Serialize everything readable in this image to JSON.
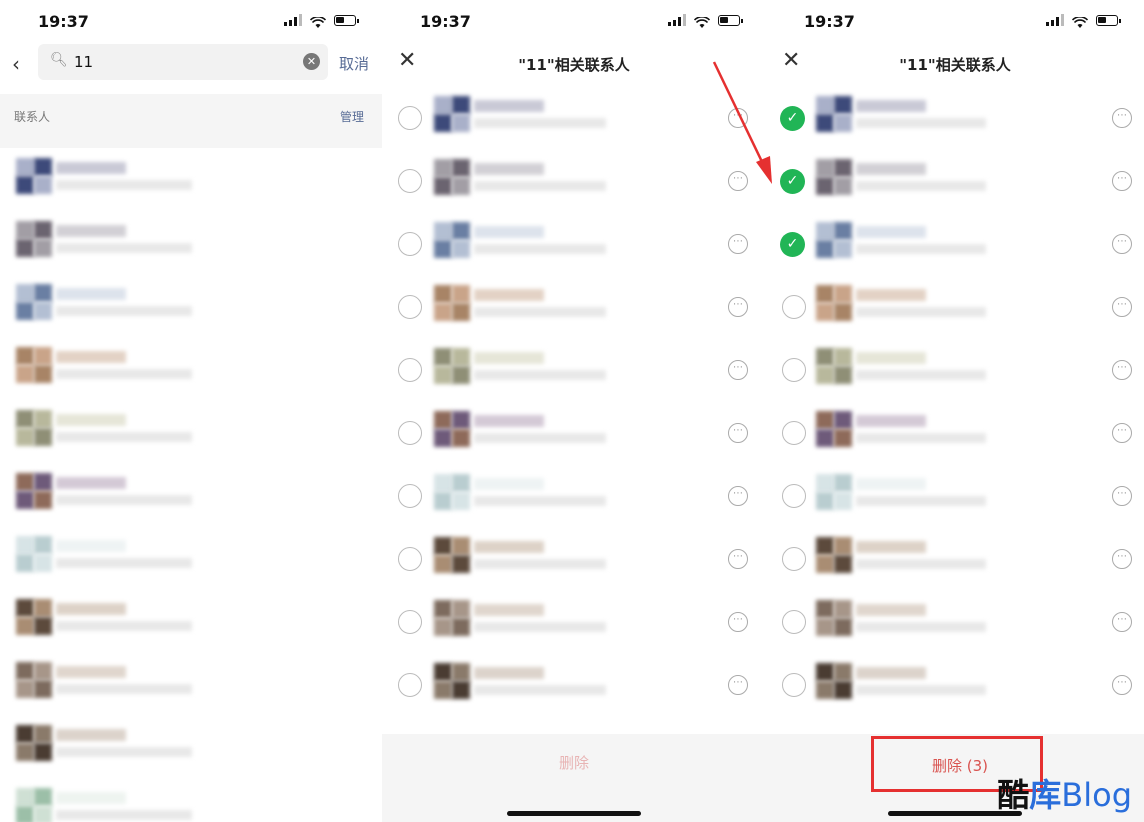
{
  "status_time": "19:37",
  "search": {
    "value": "11",
    "cancel": "取消"
  },
  "section": {
    "label": "联系人",
    "action": "管理"
  },
  "dialog_title": "\"11\"相关联系人",
  "delete_disabled": "删除",
  "delete_active": "删除 (3)",
  "watermark": {
    "part1": "酷",
    "part2": "库",
    "part3": "Blog"
  },
  "colors": {
    "check_green": "#21b556",
    "highlight_red": "#e53030",
    "link_blue": "#576b95"
  },
  "panel3_checked_rows": [
    0,
    1,
    2
  ]
}
